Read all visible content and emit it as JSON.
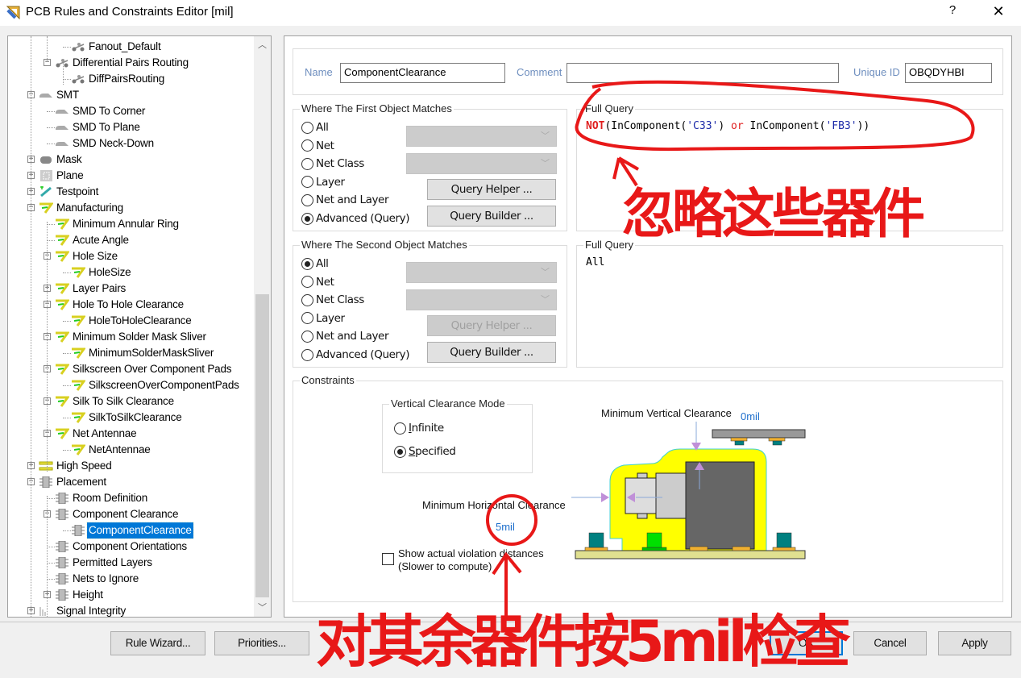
{
  "window": {
    "title": "PCB Rules and Constraints Editor [mil]",
    "help_label": "?",
    "close_label": "✕",
    "app_icon": "ruler-square-icon"
  },
  "tree": {
    "items": [
      {
        "label": "Fanout_Default",
        "level": 3,
        "icon": "routing-icon",
        "expander": null
      },
      {
        "label": "Differential Pairs Routing",
        "level": 2,
        "icon": "routing-icon",
        "expander": "-"
      },
      {
        "label": "DiffPairsRouting",
        "level": 3,
        "icon": "routing-icon",
        "expander": null
      },
      {
        "label": "SMT",
        "level": 1,
        "icon": "smt-icon",
        "expander": "-"
      },
      {
        "label": "SMD To Corner",
        "level": 2,
        "icon": "smt-icon",
        "expander": null
      },
      {
        "label": "SMD To Plane",
        "level": 2,
        "icon": "smt-icon",
        "expander": null
      },
      {
        "label": "SMD Neck-Down",
        "level": 2,
        "icon": "smt-icon",
        "expander": null
      },
      {
        "label": "Mask",
        "level": 1,
        "icon": "mask-icon",
        "expander": "+"
      },
      {
        "label": "Plane",
        "level": 1,
        "icon": "plane-icon",
        "expander": "+"
      },
      {
        "label": "Testpoint",
        "level": 1,
        "icon": "testpoint-icon",
        "expander": "+"
      },
      {
        "label": "Manufacturing",
        "level": 1,
        "icon": "manufacturing-icon",
        "expander": "-"
      },
      {
        "label": "Minimum Annular Ring",
        "level": 2,
        "icon": "manufacturing-icon",
        "expander": null
      },
      {
        "label": "Acute Angle",
        "level": 2,
        "icon": "manufacturing-icon",
        "expander": null
      },
      {
        "label": "Hole Size",
        "level": 2,
        "icon": "manufacturing-icon",
        "expander": "-"
      },
      {
        "label": "HoleSize",
        "level": 3,
        "icon": "manufacturing-icon",
        "expander": null
      },
      {
        "label": "Layer Pairs",
        "level": 2,
        "icon": "manufacturing-icon",
        "expander": "+"
      },
      {
        "label": "Hole To Hole Clearance",
        "level": 2,
        "icon": "manufacturing-icon",
        "expander": "-"
      },
      {
        "label": "HoleToHoleClearance",
        "level": 3,
        "icon": "manufacturing-icon",
        "expander": null
      },
      {
        "label": "Minimum Solder Mask Sliver",
        "level": 2,
        "icon": "manufacturing-icon",
        "expander": "-"
      },
      {
        "label": "MinimumSolderMaskSliver",
        "level": 3,
        "icon": "manufacturing-icon",
        "expander": null
      },
      {
        "label": "Silkscreen Over Component Pads",
        "level": 2,
        "icon": "manufacturing-icon",
        "expander": "-"
      },
      {
        "label": "SilkscreenOverComponentPads",
        "level": 3,
        "icon": "manufacturing-icon",
        "expander": null
      },
      {
        "label": "Silk To Silk Clearance",
        "level": 2,
        "icon": "manufacturing-icon",
        "expander": "-"
      },
      {
        "label": "SilkToSilkClearance",
        "level": 3,
        "icon": "manufacturing-icon",
        "expander": null
      },
      {
        "label": "Net Antennae",
        "level": 2,
        "icon": "manufacturing-icon",
        "expander": "-"
      },
      {
        "label": "NetAntennae",
        "level": 3,
        "icon": "manufacturing-icon",
        "expander": null
      },
      {
        "label": "High Speed",
        "level": 1,
        "icon": "high-speed-icon",
        "expander": "+"
      },
      {
        "label": "Placement",
        "level": 1,
        "icon": "placement-icon",
        "expander": "-"
      },
      {
        "label": "Room Definition",
        "level": 2,
        "icon": "placement-icon",
        "expander": null
      },
      {
        "label": "Component Clearance",
        "level": 2,
        "icon": "placement-icon",
        "expander": "-"
      },
      {
        "label": "ComponentClearance",
        "level": 3,
        "icon": "placement-icon",
        "expander": null,
        "selected": true
      },
      {
        "label": "Component Orientations",
        "level": 2,
        "icon": "placement-icon",
        "expander": null
      },
      {
        "label": "Permitted Layers",
        "level": 2,
        "icon": "placement-icon",
        "expander": null
      },
      {
        "label": "Nets to Ignore",
        "level": 2,
        "icon": "placement-icon",
        "expander": null
      },
      {
        "label": "Height",
        "level": 2,
        "icon": "placement-icon",
        "expander": "+"
      },
      {
        "label": "Signal Integrity",
        "level": 1,
        "icon": "signal-integrity-icon",
        "expander": "+"
      }
    ]
  },
  "rule": {
    "name_label": "Name",
    "name_value": "ComponentClearance",
    "comment_label": "Comment",
    "comment_value": "",
    "uid_label": "Unique ID",
    "uid_value": "OBQDYHBI"
  },
  "first_match": {
    "title": "Where The First Object Matches",
    "options": [
      "All",
      "Net",
      "Net Class",
      "Layer",
      "Net and Layer",
      "Advanced (Query)"
    ],
    "selected": "Advanced (Query)",
    "query_helper_label": "Query Helper ...",
    "query_builder_label": "Query Builder ...",
    "full_query_title": "Full Query",
    "full_query": {
      "not_kw": "NOT",
      "part1": "(InComponent(",
      "str1": "'C33'",
      "part2": ") ",
      "or_kw": "or",
      "part3": " InComponent(",
      "str2": "'FB3'",
      "part4": "))"
    }
  },
  "second_match": {
    "title": "Where The Second Object Matches",
    "options": [
      "All",
      "Net",
      "Net Class",
      "Layer",
      "Net and Layer",
      "Advanced (Query)"
    ],
    "selected": "All",
    "query_helper_label": "Query Helper ...",
    "query_builder_label": "Query Builder ...",
    "full_query_title": "Full Query",
    "full_query": "All"
  },
  "constraints": {
    "title": "Constraints",
    "vertical_mode_title": "Vertical Clearance Mode",
    "vertical_mode_options": [
      "Infinite",
      "Specified"
    ],
    "vertical_mode_selected": "Specified",
    "min_vertical_label": "Minimum Vertical Clearance",
    "min_vertical_value": "0mil",
    "min_horizontal_label": "Minimum Horizontal Clearance",
    "min_horizontal_value": "5mil",
    "show_violation_label_1": "Show actual violation distances",
    "show_violation_label_2": "(Slower to compute)",
    "show_violation_checked": false
  },
  "buttons": {
    "rule_wizard": "Rule Wizard...",
    "priorities": "Priorities...",
    "ok": "OK",
    "cancel": "Cancel",
    "apply": "Apply"
  },
  "annotations": {
    "top_note": "忽略这些器件",
    "bottom_note": "对其余器件按5mil检查",
    "color": "#e81818"
  }
}
